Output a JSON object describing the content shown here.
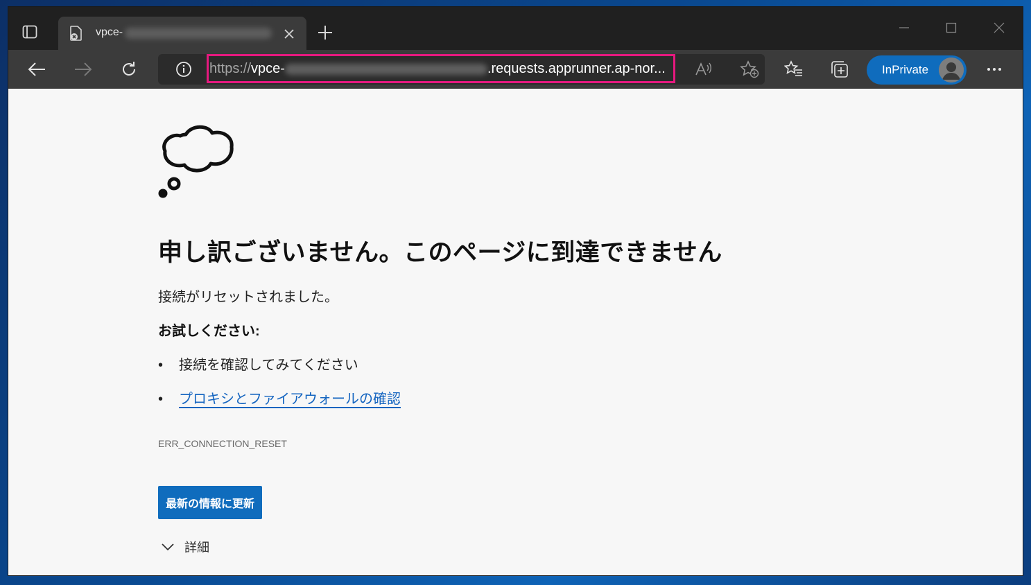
{
  "browser": {
    "tab": {
      "title_prefix": "vpce-",
      "favicon": "page-error-icon",
      "close_icon": "close-icon"
    },
    "new_tab_icon": "plus-icon",
    "window_controls": [
      "minimize-icon",
      "maximize-icon",
      "close-icon"
    ],
    "toolbar": {
      "back_icon": "arrow-left-icon",
      "forward_icon": "arrow-right-icon",
      "refresh_icon": "refresh-icon",
      "site_info_icon": "info-icon",
      "url_protocol": "https://",
      "url_prefix": "vpce-",
      "url_suffix": ".requests.apprunner.ap-nor...",
      "read_aloud_icon": "read-aloud-icon",
      "add_favorite_icon": "star-add-icon",
      "favorites_icon": "favorites-icon",
      "collections_icon": "collections-icon",
      "inprivate_label": "InPrivate",
      "menu_icon": "more-icon"
    },
    "highlight_color": "#e6197f"
  },
  "page": {
    "illustration": "thought-cloud-icon",
    "headline": "申し訳ございません。このページに到達できません",
    "message": "接続がリセットされました。",
    "try_label": "お試しください:",
    "suggestions": [
      {
        "bullet": "•",
        "text": "接続を確認してみてください",
        "is_link": false
      },
      {
        "bullet": "•",
        "text": "プロキシとファイアウォールの確認",
        "is_link": true
      }
    ],
    "error_code": "ERR_CONNECTION_RESET",
    "refresh_button": "最新の情報に更新",
    "details_label": "詳細",
    "accent_color": "#0f6cbd"
  }
}
